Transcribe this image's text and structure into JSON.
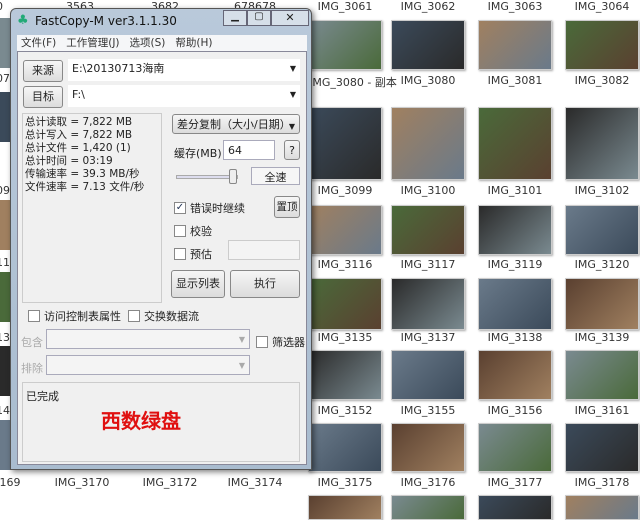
{
  "window": {
    "title": "FastCopy-M ver3.1.1.30",
    "menu": [
      "文件(F)",
      "工作管理(J)",
      "选项(S)",
      "帮助(H)"
    ]
  },
  "source": {
    "label": "来源",
    "value": "E:\\20130713海南"
  },
  "target": {
    "label": "目标",
    "value": "F:\\"
  },
  "stats": [
    "总计读取 = 7,822 MB",
    "总计写入 = 7,822 MB",
    "总计文件 = 1,420 (1)",
    "总计时间 = 03:19",
    "传输速率 = 39.3 MB/秒",
    "文件速率 = 7.13 文件/秒"
  ],
  "mode": "差分复制（大小/日期）",
  "buffer": {
    "label": "缓存(MB)",
    "value": "64",
    "help": "?"
  },
  "speed": {
    "label": "全速",
    "slider_fraction": 0.92
  },
  "options": {
    "continue_on_error": "错误时继续",
    "verify": "校验",
    "estimate": "预估",
    "topmost": "置顶",
    "acl": "访问控制表属性",
    "streams": "交换数据流",
    "filter": "筛选器",
    "include": "包含",
    "exclude": "排除"
  },
  "buttons": {
    "list": "显示列表",
    "execute": "执行"
  },
  "status": "已完成",
  "watermark": "西数绿盘",
  "explorer": {
    "top_labels": [
      "3563",
      "3682",
      "678678"
    ],
    "left_partial": [
      "0",
      "07",
      "09",
      "11",
      "13",
      "14"
    ],
    "rows": [
      [
        "IMG_3061",
        "IMG_3062",
        "IMG_3063",
        "IMG_3064"
      ],
      [
        "IMG_3080 - 副本",
        "IMG_3080",
        "IMG_3081",
        "IMG_3082"
      ],
      [
        "IMG_3099",
        "IMG_3100",
        "IMG_3101",
        "IMG_3102"
      ],
      [
        "IMG_3116",
        "IMG_3117",
        "IMG_3119",
        "IMG_3120"
      ],
      [
        "IMG_3135",
        "IMG_3137",
        "IMG_3138",
        "IMG_3139"
      ],
      [
        "IMG_3152",
        "IMG_3155",
        "IMG_3156",
        "IMG_3161"
      ],
      [
        "IMG_3175",
        "IMG_3176",
        "IMG_3177",
        "IMG_3178"
      ]
    ],
    "bottom_left": [
      "169",
      "IMG_3170",
      "IMG_3172",
      "IMG_3174"
    ]
  }
}
